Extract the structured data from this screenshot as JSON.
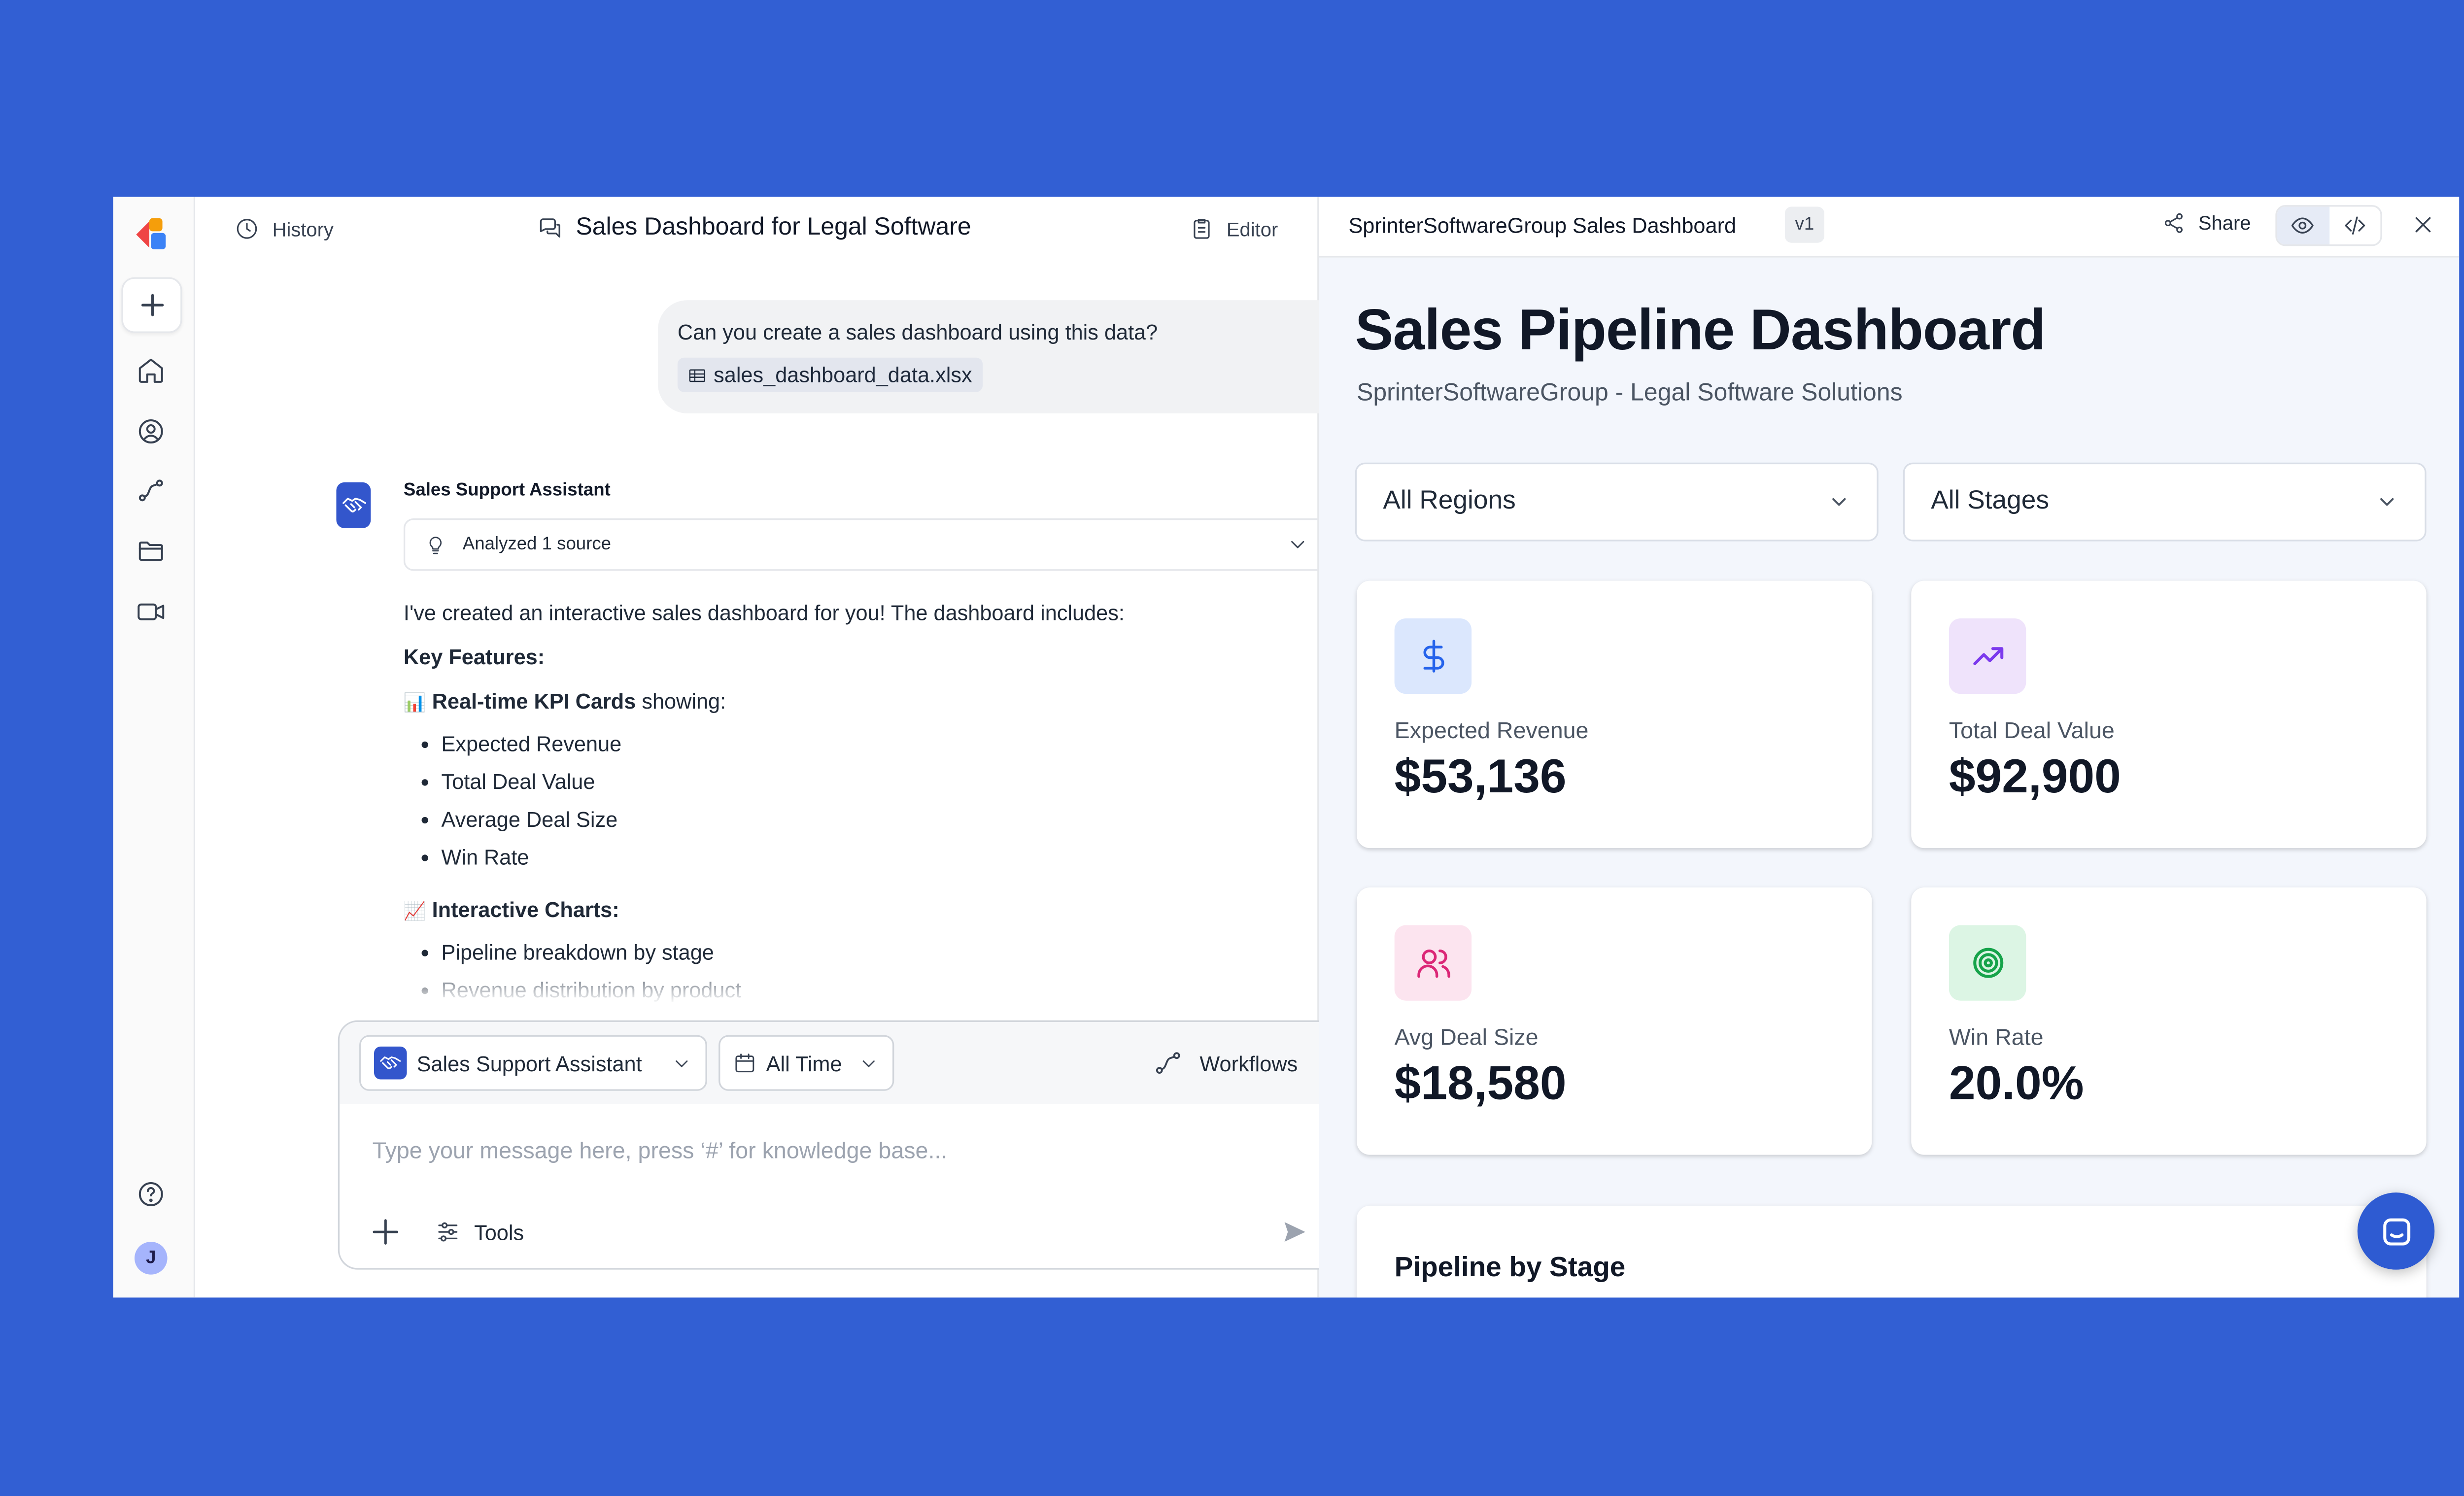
{
  "chat": {
    "history_label": "History",
    "title": "Sales Dashboard for Legal Software",
    "editor_label": "Editor",
    "user_message": "Can you create a sales dashboard using this data?",
    "attachment": "sales_dashboard_data.xlsx",
    "assistant_name": "Sales Support Assistant",
    "analyzed_label": "Analyzed 1 source",
    "intro": "I've created an interactive sales dashboard for you! The dashboard includes:",
    "key_features": "Key Features:",
    "kpi_emoji": "📊",
    "kpi_heading_bold": "Real-time KPI Cards",
    "kpi_heading_rest": " showing:",
    "kpi_items": [
      "Expected Revenue",
      "Total Deal Value",
      "Average Deal Size",
      "Win Rate"
    ],
    "charts_emoji": "📈",
    "charts_heading": "Interactive Charts:",
    "chart_items": [
      "Pipeline breakdown by stage",
      "Revenue distribution by product"
    ]
  },
  "composer": {
    "assistant_select": "Sales Support Assistant",
    "time_select": "All Time",
    "workflows_label": "Workflows",
    "placeholder": "Type your message here, press ‘#’ for knowledge base...",
    "tools_label": "Tools"
  },
  "user": {
    "initial": "J"
  },
  "dashboard": {
    "window_title": "SprinterSoftwareGroup Sales Dashboard",
    "version": "v1",
    "share_label": "Share",
    "heading": "Sales Pipeline Dashboard",
    "subheading": "SprinterSoftwareGroup - Legal Software Solutions",
    "filters": {
      "region": "All Regions",
      "stage": "All Stages"
    },
    "kpis": [
      {
        "label": "Expected Revenue",
        "value": "$53,136",
        "icon": "dollar-icon",
        "bg": "#dbe7fd",
        "color": "#2563eb"
      },
      {
        "label": "Total Deal Value",
        "value": "$92,900",
        "icon": "trending-up-icon",
        "bg": "#efe3fb",
        "color": "#7c3aed"
      },
      {
        "label": "Avg Deal Size",
        "value": "$18,580",
        "icon": "users-icon",
        "bg": "#fce4ef",
        "color": "#db2777"
      },
      {
        "label": "Win Rate",
        "value": "20.0%",
        "icon": "target-icon",
        "bg": "#dcf5e4",
        "color": "#16a34a"
      }
    ],
    "pipeline_title": "Pipeline by Stage"
  },
  "colors": {
    "background": "#325fd3",
    "accent": "#3356cc"
  }
}
